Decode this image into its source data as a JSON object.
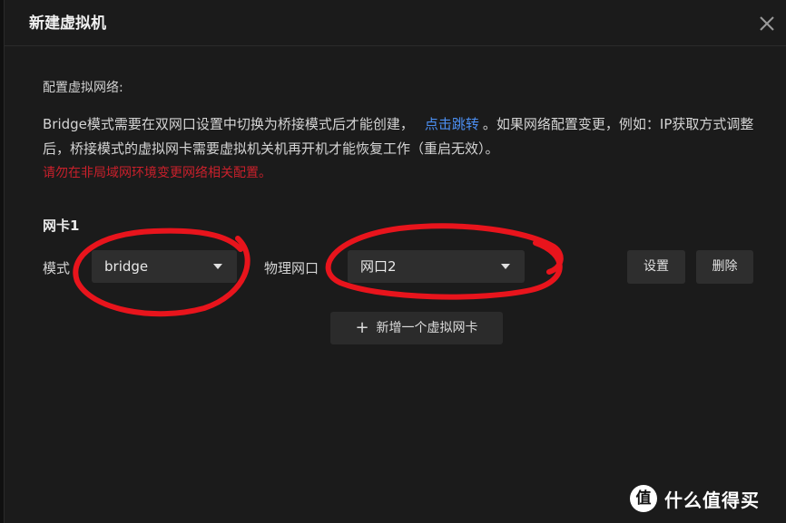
{
  "dialog": {
    "title": "新建虚拟机",
    "close_icon": "close-icon"
  },
  "network": {
    "section_label": "配置虚拟网络:",
    "desc_part1": "Bridge模式需要在双网口设置中切换为桥接模式后才能创建，",
    "link_text": "点击跳转",
    "desc_part2": "。如果网络配置变更，例如：IP获取方式调整后，桥接模式的虚拟网卡需要虚拟机关机再开机才能恢复工作（重启无效）。",
    "warning": "请勿在非局域网环境变更网络相关配置。"
  },
  "nic": {
    "title": "网卡1",
    "mode_label": "模式",
    "mode_value": "bridge",
    "port_label": "物理网口",
    "port_value": "网口2",
    "settings_label": "设置",
    "delete_label": "删除"
  },
  "add_nic": {
    "label": "新增一个虚拟网卡"
  },
  "watermark": {
    "logo_char": "值",
    "text": "什么值得买"
  },
  "colors": {
    "link": "#4c8ff2",
    "warning": "#c8202b",
    "annotation": "#e8141c"
  }
}
